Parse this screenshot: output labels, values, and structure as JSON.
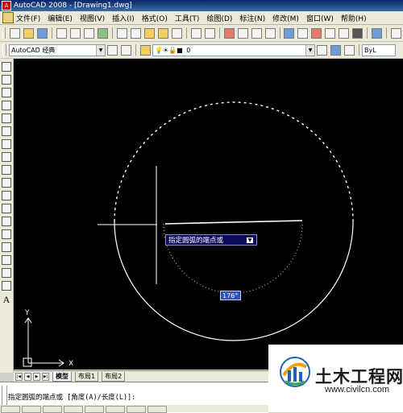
{
  "window": {
    "title": "AutoCAD 2008 - [Drawing1.dwg]"
  },
  "menu": {
    "items": [
      "文件(F)",
      "编辑(E)",
      "视图(V)",
      "插入(I)",
      "格式(O)",
      "工具(T)",
      "绘图(D)",
      "标注(N)",
      "修改(M)",
      "窗口(W)",
      "帮助(H)"
    ]
  },
  "toolbar2": {
    "workspace": "AutoCAD 经典",
    "layer": "0",
    "color": "ByL"
  },
  "canvas": {
    "tooltip": "指定圆弧的端点或",
    "tooltip_icon": "arrow-down-icon",
    "dyn_value": "176°",
    "ucs_x": "X",
    "ucs_y": "Y",
    "colors": {
      "background": "#000000",
      "geometry": "#ffffff",
      "tooltip_bg": "#0a0a5a",
      "input_bg": "#3050c0"
    }
  },
  "tabs": {
    "model": "模型",
    "layout1": "布局1",
    "layout2": "布局2"
  },
  "command": {
    "line": "指定圆弧的端点或 [角度(A)/长度(L)]:"
  },
  "watermark": {
    "brand": "土木工程网",
    "url": "www.civilcn.com"
  }
}
